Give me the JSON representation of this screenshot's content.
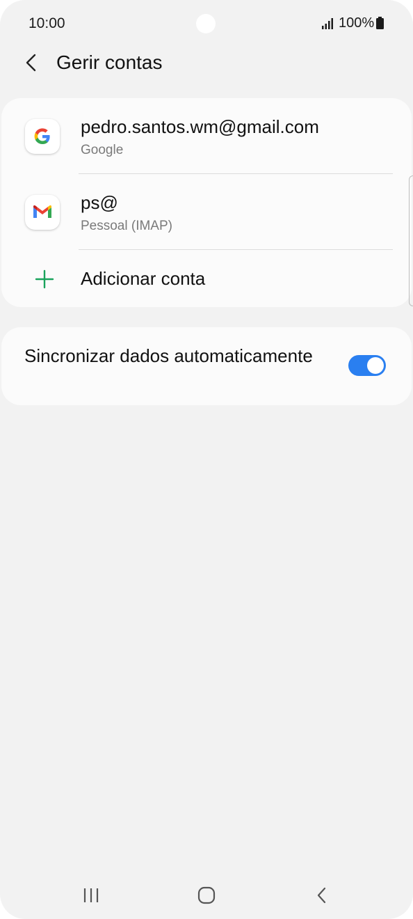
{
  "status_bar": {
    "time": "10:00",
    "battery_percent": "100%",
    "signal_icon": "signal-bars-icon",
    "battery_icon": "battery-full-icon"
  },
  "header": {
    "title": "Gerir contas",
    "back_icon": "chevron-left-icon"
  },
  "accounts": [
    {
      "name": "pedro.santos.wm@gmail.com",
      "type": "Google",
      "icon": "google-icon"
    },
    {
      "name": "ps@",
      "type": "Pessoal (IMAP)",
      "icon": "gmail-icon"
    }
  ],
  "add_account": {
    "label": "Adicionar conta",
    "icon": "plus-icon",
    "icon_color": "#1aa35c"
  },
  "sync": {
    "label": "Sincronizar dados automaticamente",
    "enabled": true,
    "toggle_color": "#2a7ff0"
  },
  "nav_bar": {
    "recents_icon": "recents-icon",
    "home_icon": "home-icon",
    "back_icon": "back-icon"
  }
}
